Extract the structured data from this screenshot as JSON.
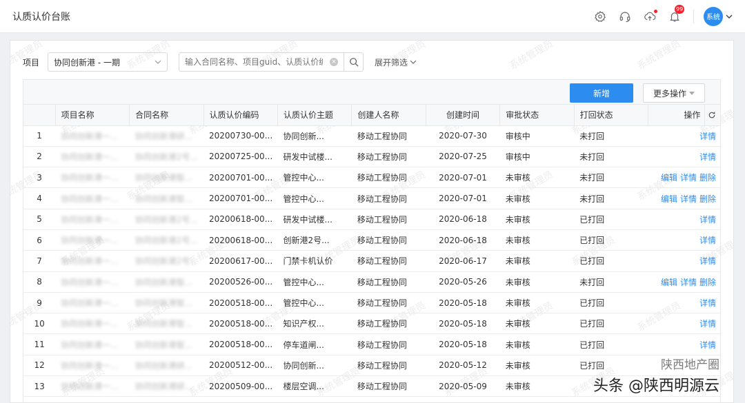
{
  "header": {
    "title": "认质认价台账",
    "notification_count": "99",
    "user": "系统"
  },
  "filters": {
    "project_label": "项目",
    "project_value": "协同创新港 - 一期",
    "search_placeholder": "输入合同名称、项目guid、认质认价编",
    "expand_label": "展开筛选"
  },
  "toolbar": {
    "new_label": "新增",
    "more_label": "更多操作"
  },
  "table": {
    "columns": [
      "项目名称",
      "合同名称",
      "认质认价编码",
      "认质认价主题",
      "创建人名称",
      "创建时间",
      "审批状态",
      "打回状态",
      "操作"
    ],
    "rows": [
      {
        "idx": "1",
        "project": "协同创新港一...",
        "contract": "协同创新港研...",
        "code": "20200730-00...",
        "subject": "协同创新...",
        "creator": "移动工程协同",
        "time": "2020-07-30",
        "approval": "审核中",
        "returned": "未打回",
        "ops": [
          "详情"
        ]
      },
      {
        "idx": "2",
        "project": "协同创新港一...",
        "contract": "协同创新港2号...",
        "code": "20200725-00...",
        "subject": "研发中试楼...",
        "creator": "移动工程协同",
        "time": "2020-07-25",
        "approval": "审核中",
        "returned": "未打回",
        "ops": [
          "详情"
        ]
      },
      {
        "idx": "3",
        "project": "协同创新港一...",
        "contract": "协同创新港智...",
        "code": "20200701-00...",
        "subject": "管控中心...",
        "creator": "移动工程协同",
        "time": "2020-07-01",
        "approval": "未审核",
        "returned": "未打回",
        "ops": [
          "编辑",
          "详情",
          "删除"
        ]
      },
      {
        "idx": "4",
        "project": "协同创新港一...",
        "contract": "协同创新港智...",
        "code": "20200701-00...",
        "subject": "管控中心...",
        "creator": "移动工程协同",
        "time": "2020-07-01",
        "approval": "未审核",
        "returned": "未打回",
        "ops": [
          "编辑",
          "详情",
          "删除"
        ]
      },
      {
        "idx": "5",
        "project": "协同创新港一...",
        "contract": "协同创新港2号...",
        "code": "20200618-00...",
        "subject": "研发中试楼...",
        "creator": "移动工程协同",
        "time": "2020-06-18",
        "approval": "未审核",
        "returned": "已打回",
        "ops": [
          "详情"
        ]
      },
      {
        "idx": "6",
        "project": "协同创新港一...",
        "contract": "协同创新港2号...",
        "code": "20200618-00...",
        "subject": "创新港2号...",
        "creator": "移动工程协同",
        "time": "2020-06-18",
        "approval": "未审核",
        "returned": "已打回",
        "ops": [
          "详情"
        ]
      },
      {
        "idx": "7",
        "project": "协同创新港一...",
        "contract": "协同创新港2号...",
        "code": "20200617-00...",
        "subject": "门禁卡机认价",
        "creator": "移动工程协同",
        "time": "2020-06-17",
        "approval": "未审核",
        "returned": "已打回",
        "ops": [
          "详情"
        ]
      },
      {
        "idx": "8",
        "project": "协同创新港一...",
        "contract": "协同创新港智...",
        "code": "20200526-00...",
        "subject": "管控中心...",
        "creator": "移动工程协同",
        "time": "2020-05-26",
        "approval": "未审核",
        "returned": "未打回",
        "ops": [
          "编辑",
          "详情",
          "删除"
        ]
      },
      {
        "idx": "9",
        "project": "协同创新港一...",
        "contract": "协同创新港智...",
        "code": "20200518-00...",
        "subject": "管控中心...",
        "creator": "移动工程协同",
        "time": "2020-05-18",
        "approval": "未审核",
        "returned": "已打回",
        "ops": [
          "详情"
        ]
      },
      {
        "idx": "10",
        "project": "协同创新港一...",
        "contract": "协同创新港智...",
        "code": "20200518-00...",
        "subject": "知识产权...",
        "creator": "移动工程协同",
        "time": "2020-05-18",
        "approval": "未审核",
        "returned": "已打回",
        "ops": [
          "详情"
        ]
      },
      {
        "idx": "11",
        "project": "协同创新港一...",
        "contract": "协同创新港智...",
        "code": "20200518-00...",
        "subject": "停车道闸...",
        "creator": "移动工程协同",
        "time": "2020-05-18",
        "approval": "未审核",
        "returned": "已打回",
        "ops": [
          "详情"
        ]
      },
      {
        "idx": "12",
        "project": "协同创新港一...",
        "contract": "协同创新港研...",
        "code": "20200512-00...",
        "subject": "协同创新...",
        "creator": "移动工程协同",
        "time": "2020-05-12",
        "approval": "未审核",
        "returned": "已打回",
        "ops": []
      },
      {
        "idx": "13",
        "project": "协同创新港一...",
        "contract": "协同创新港研...",
        "code": "20200509-00...",
        "subject": "楼层空调...",
        "creator": "移动工程协同",
        "time": "2020-05-09",
        "approval": "未审核",
        "returned": "",
        "ops": []
      }
    ]
  },
  "watermark_text": "系统管理员",
  "overlay": {
    "line1": "陕西地产圈",
    "line2": "头条 @陕西明源云"
  }
}
